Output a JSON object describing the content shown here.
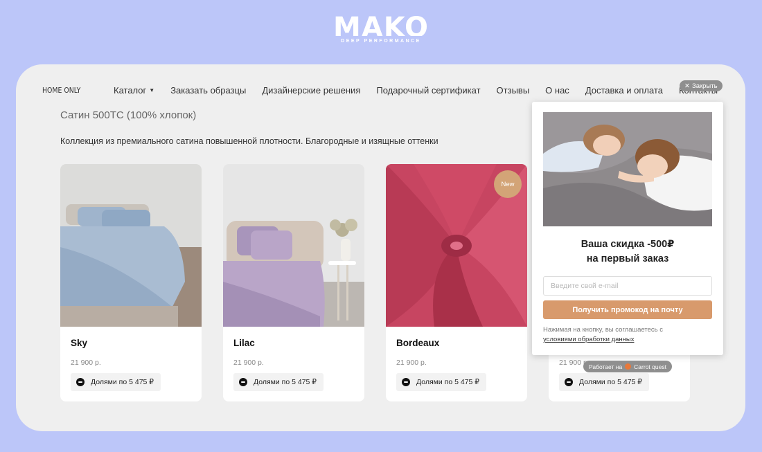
{
  "brand": {
    "name": "MAKO",
    "tagline": "DEEP PERFORMANCE"
  },
  "site": {
    "logo": "HOME ONLY",
    "nav": [
      "Каталог",
      "Заказать образцы",
      "Дизайнерские решения",
      "Подарочный сертификат",
      "Отзывы",
      "О нас",
      "Доставка и оплата",
      "Контакты"
    ]
  },
  "section": {
    "title": "Сатин 500ТС (100% хлопок)",
    "description": "Коллекция из премиального сатина повышенной плотности. Благородные и изящные оттенки"
  },
  "products": [
    {
      "name": "Sky",
      "price": "21 900 р.",
      "installment": "Долями по 5 475 ₽",
      "color": "#a9bcd2"
    },
    {
      "name": "Lilac",
      "price": "21 900 р.",
      "installment": "Долями по 5 475 ₽",
      "color": "#b9a5c8"
    },
    {
      "name": "Bordeaux",
      "price": "21 900 р.",
      "installment": "Долями по 5 475 ₽",
      "badge": "New",
      "color": "#c74561"
    },
    {
      "price": "21 900 р.",
      "installment": "Долями по 5 475 ₽"
    }
  ],
  "popup": {
    "title_line1": "Ваша скидка -500₽",
    "title_line2": "на первый заказ",
    "email_placeholder": "Введите свой e-mail",
    "button_label": "Получить промокод на почту",
    "consent_text": "Нажимая на кнопку, вы соглашаетесь с",
    "consent_link": "условиями обработки данных",
    "close_label": "Закрыть",
    "powered_by": "Работает на",
    "powered_by_name": "Carrot quest"
  },
  "colors": {
    "page_bg": "#bcc6f9",
    "window_bg": "#efefef",
    "accent": "#d89a6c",
    "badge": "#d3a477"
  }
}
